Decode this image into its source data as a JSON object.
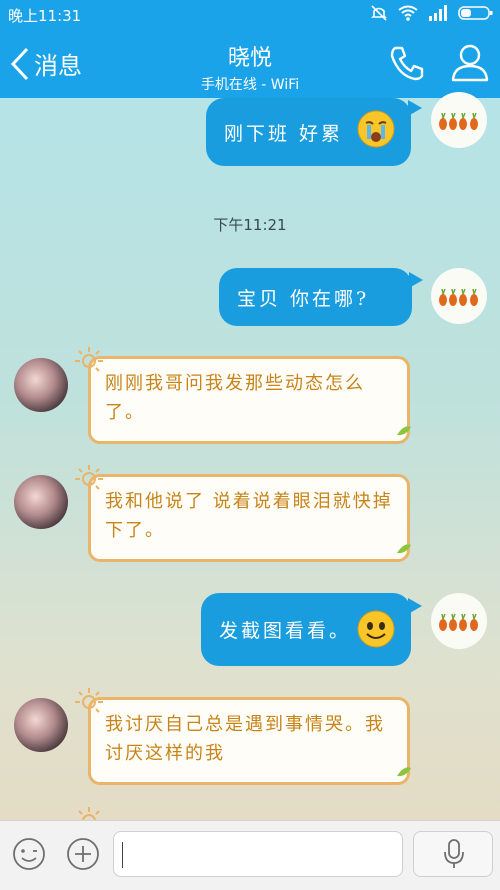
{
  "status_bar": {
    "time": "晚上11:31"
  },
  "header": {
    "back_label": "消息",
    "title": "晓悦",
    "subtitle": "手机在线 - WiFi"
  },
  "messages": [
    {
      "side": "right",
      "text": "刚下班  好累"
    },
    {
      "side": "right",
      "text": "宝贝    你在哪?"
    },
    {
      "side": "left",
      "text": "刚刚我哥问我发那些动态怎么了。"
    },
    {
      "side": "left",
      "text": "我和他说了    说着说着眼泪就快掉下了。"
    },
    {
      "side": "right",
      "text": "发截图看看。"
    },
    {
      "side": "left",
      "text": "我讨厌自己总是遇到事情哭。我讨厌这样的我"
    }
  ],
  "timestamp": "下午11:21",
  "colors": {
    "accent": "#1aa3e8",
    "bubble_blue": "#1a9ddf",
    "bubble_text_orange": "#c78418"
  },
  "icons": [
    "back-chevron-icon",
    "phone-icon",
    "profile-icon",
    "smiley-icon",
    "plus-icon",
    "microphone-icon",
    "crying-emoji-icon",
    "smile-emoji-icon"
  ]
}
